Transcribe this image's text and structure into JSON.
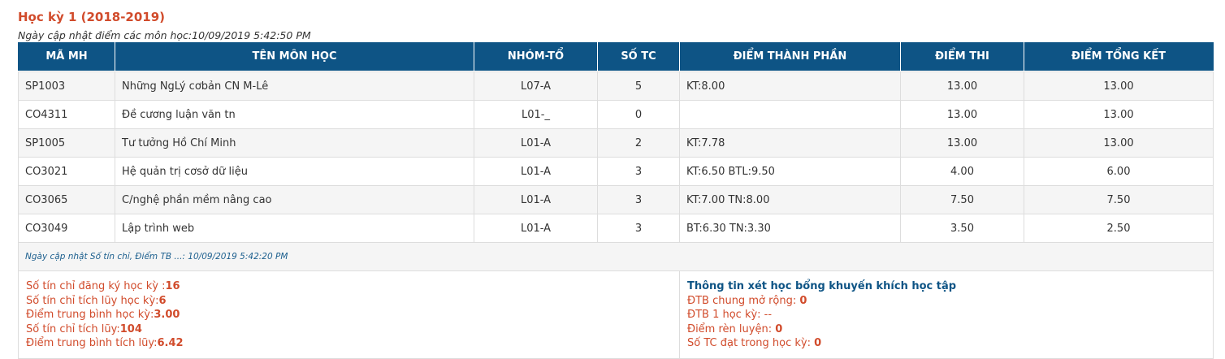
{
  "semester_title": "Học kỳ 1 (2018-2019)",
  "updated_line": "Ngày cập nhật điểm các môn học:10/09/2019 5:42:50 PM",
  "table": {
    "headers": [
      "MÃ MH",
      "TÊN MÔN HỌC",
      "NHÓM-TỔ",
      "SỐ TC",
      "ĐIỂM THÀNH PHẦN",
      "ĐIỂM THI",
      "ĐIỂM TỔNG KẾT"
    ],
    "rows": [
      {
        "code": "SP1003",
        "name": "Những NgLý cơbản CN M-Lê",
        "group": "L07-A",
        "credits": "5",
        "components": "KT:8.00",
        "exam": "13.00",
        "total": "13.00"
      },
      {
        "code": "CO4311",
        "name": "Đề cương luận văn tn",
        "group": "L01-_",
        "credits": "0",
        "components": "",
        "exam": "13.00",
        "total": "13.00"
      },
      {
        "code": "SP1005",
        "name": "Tư tưởng Hồ Chí Minh",
        "group": "L01-A",
        "credits": "2",
        "components": "KT:7.78",
        "exam": "13.00",
        "total": "13.00"
      },
      {
        "code": "CO3021",
        "name": "Hệ quản trị cơsở dữ liệu",
        "group": "L01-A",
        "credits": "3",
        "components": "KT:6.50 BTL:9.50",
        "exam": "4.00",
        "total": "6.00"
      },
      {
        "code": "CO3065",
        "name": "C/nghệ phần mềm nâng cao",
        "group": "L01-A",
        "credits": "3",
        "components": "KT:7.00 TN:8.00",
        "exam": "7.50",
        "total": "7.50"
      },
      {
        "code": "CO3049",
        "name": "Lập trình web",
        "group": "L01-A",
        "credits": "3",
        "components": "BT:6.30 TN:3.30",
        "exam": "3.50",
        "total": "2.50"
      }
    ]
  },
  "summary_note": "Ngày cập nhật Số tín chỉ, Điểm TB ...: 10/09/2019 5:42:20 PM",
  "summary_left": [
    {
      "label": "Số tín chỉ đăng ký học kỳ :",
      "value": "16"
    },
    {
      "label": "Số tín chỉ tích lũy học kỳ:",
      "value": "6"
    },
    {
      "label": "Điểm trung bình học kỳ:",
      "value": "3.00"
    },
    {
      "label": "Số tín chỉ tích lũy:",
      "value": "104"
    },
    {
      "label": "Điểm trung bình tích lũy:",
      "value": "6.42"
    }
  ],
  "scholarship": {
    "title": "Thông tin xét học bổng khuyến khích học tập",
    "items": [
      {
        "label": "ĐTB chung mở rộng: ",
        "value": "0"
      },
      {
        "label": "ĐTB 1 học kỳ: --",
        "value": ""
      },
      {
        "label": "Điểm rèn luyện: ",
        "value": "0"
      },
      {
        "label": "Số TC đạt trong học kỳ: ",
        "value": "0"
      }
    ]
  },
  "colors": {
    "header_bg": "#0e5485",
    "accent_red": "#d14b2b",
    "note_blue": "#1c5f8e"
  }
}
